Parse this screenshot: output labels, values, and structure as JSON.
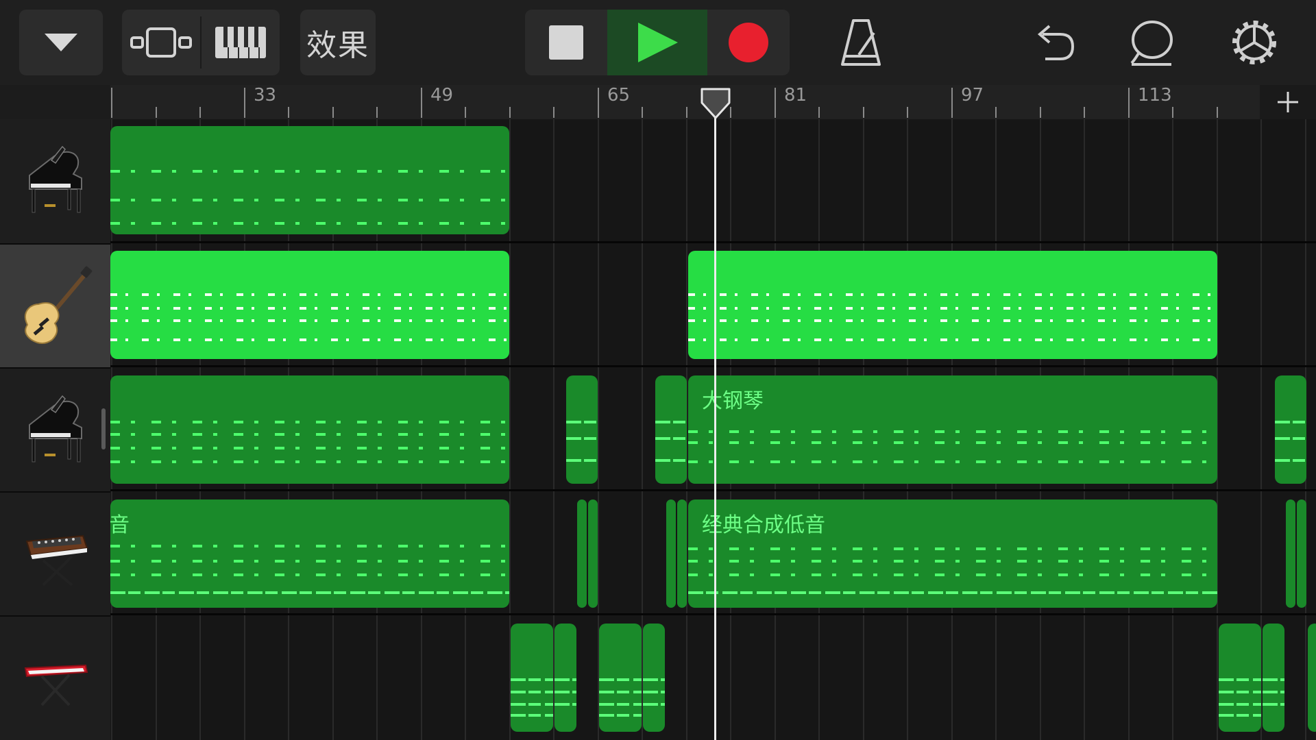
{
  "toolbar": {
    "effects_label": "效果"
  },
  "ruler": {
    "bar_numbers": [
      "33",
      "49",
      "65",
      "81",
      "97",
      "113"
    ]
  },
  "tracks": [
    {
      "icon": "grand-piano-icon",
      "selected": false
    },
    {
      "icon": "electric-guitar-icon",
      "selected": true
    },
    {
      "icon": "grand-piano-icon",
      "selected": false
    },
    {
      "icon": "synth-bass-icon",
      "selected": false
    },
    {
      "icon": "keyboard-icon",
      "selected": false
    }
  ],
  "regions": {
    "piano_title": "大钢琴",
    "bass_title": "经典合成低音",
    "bass_title_cut": "音"
  },
  "colors": {
    "region_dark": "#1a8a2a",
    "region_bright": "#26dd44",
    "record": "#e8202e",
    "play": "#3ddc4a"
  }
}
